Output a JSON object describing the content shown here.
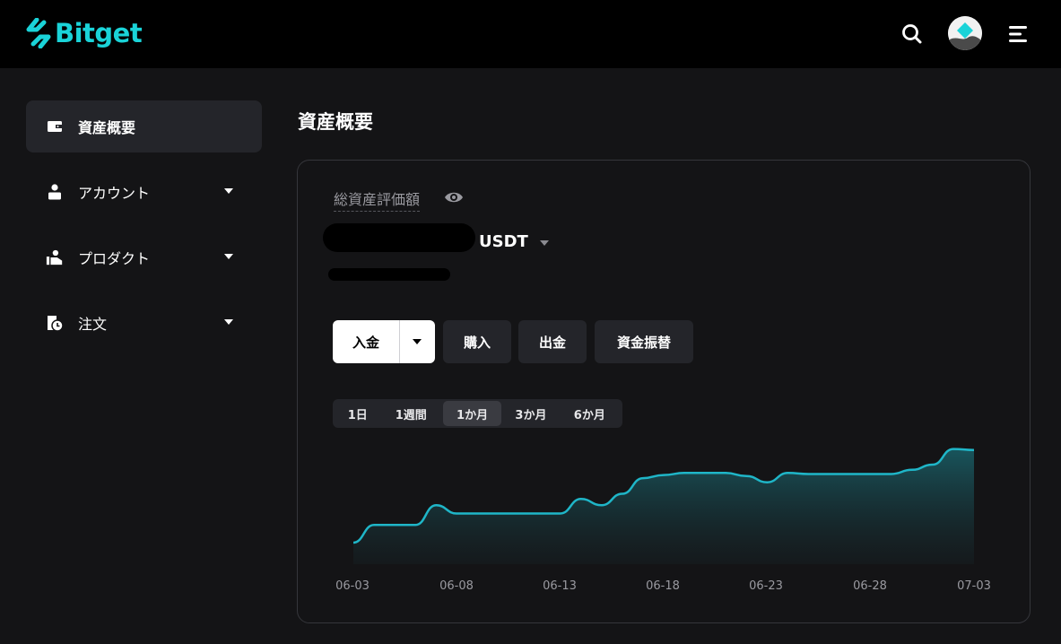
{
  "brand": {
    "name": "Bitget",
    "accent": "#1ad3d8"
  },
  "topbar": {
    "icons": [
      "search-icon",
      "avatar",
      "menu-icon"
    ]
  },
  "sidebar": {
    "items": [
      {
        "label": "資産概要",
        "icon": "wallet-icon",
        "active": true
      },
      {
        "label": "アカウント",
        "icon": "person-icon",
        "expandable": true
      },
      {
        "label": "プロダクト",
        "icon": "product-icon",
        "expandable": true
      },
      {
        "label": "注文",
        "icon": "order-icon",
        "expandable": true
      }
    ]
  },
  "page": {
    "title": "資産概要"
  },
  "summary": {
    "total_label": "総資産評価額",
    "unit": "USDT"
  },
  "actions": {
    "deposit": "入金",
    "buy": "購入",
    "withdraw": "出金",
    "transfer": "資金振替"
  },
  "range_tabs": [
    {
      "label": "1日"
    },
    {
      "label": "1週間"
    },
    {
      "label": "1か月",
      "active": true
    },
    {
      "label": "3か月"
    },
    {
      "label": "6か月"
    }
  ],
  "chart_data": {
    "type": "area",
    "color": "#1fb6c8",
    "x_tick_labels": [
      "06-03",
      "06-08",
      "06-13",
      "06-18",
      "06-23",
      "06-28",
      "07-03"
    ],
    "x": [
      "06-03",
      "06-04",
      "06-05",
      "06-06",
      "06-07",
      "06-08",
      "06-09",
      "06-10",
      "06-11",
      "06-12",
      "06-13",
      "06-14",
      "06-15",
      "06-16",
      "06-17",
      "06-18",
      "06-19",
      "06-20",
      "06-21",
      "06-22",
      "06-23",
      "06-24",
      "06-25",
      "06-26",
      "06-27",
      "06-28",
      "06-29",
      "06-30",
      "07-01",
      "07-02",
      "07-03"
    ],
    "values": [
      0.0,
      0.17,
      0.17,
      0.17,
      0.36,
      0.28,
      0.28,
      0.28,
      0.28,
      0.28,
      0.28,
      0.42,
      0.36,
      0.47,
      0.62,
      0.65,
      0.67,
      0.67,
      0.67,
      0.64,
      0.58,
      0.67,
      0.66,
      0.66,
      0.66,
      0.66,
      0.66,
      0.7,
      0.75,
      0.9,
      0.89
    ],
    "grid": false,
    "legend": "none"
  }
}
